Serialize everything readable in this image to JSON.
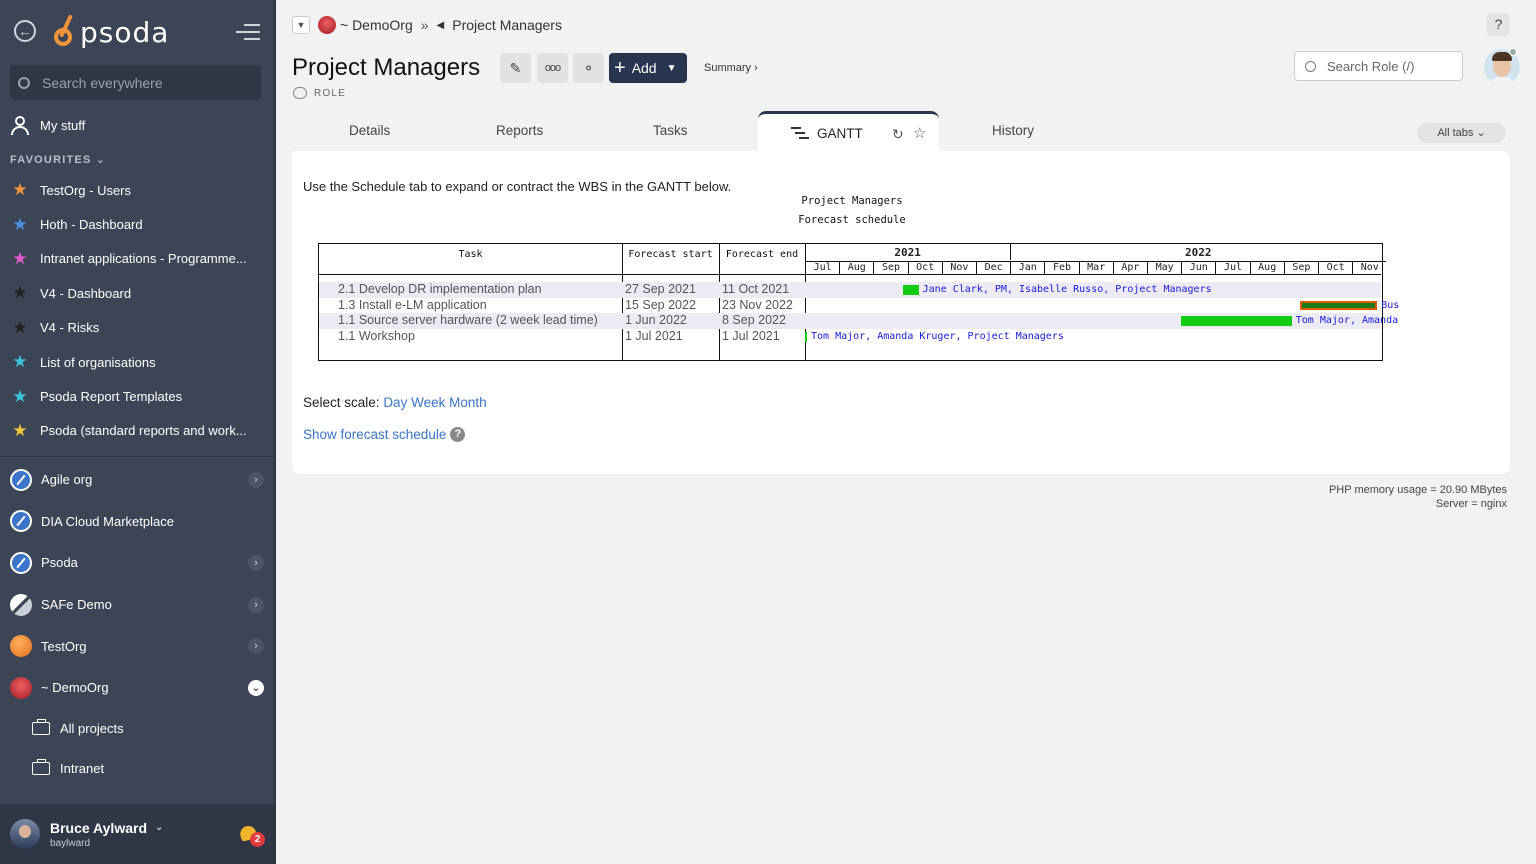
{
  "sidebar": {
    "logo_text": "psoda",
    "search_placeholder": "Search everywhere",
    "my_stuff": "My stuff",
    "favourites_header": "FAVOURITES",
    "favourites": [
      {
        "label": "TestOrg - Users",
        "color": "#f0953a"
      },
      {
        "label": "Hoth - Dashboard",
        "color": "#4a8fe0"
      },
      {
        "label": "Intranet applications - Programme...",
        "color": "#e05ad0"
      },
      {
        "label": "V4 - Dashboard",
        "color": "#222222"
      },
      {
        "label": "V4 - Risks",
        "color": "#222222"
      },
      {
        "label": "List of organisations",
        "color": "#3bc4d8"
      },
      {
        "label": "Psoda Report Templates",
        "color": "#3bc4d8"
      },
      {
        "label": "Psoda (standard reports and work...",
        "color": "#f0c43a"
      }
    ],
    "orgs": [
      {
        "label": "Agile org",
        "icon": "compass",
        "chevron": true
      },
      {
        "label": "DIA Cloud Marketplace",
        "icon": "compass",
        "chevron": false
      },
      {
        "label": "Psoda",
        "icon": "compass",
        "chevron": true
      },
      {
        "label": "SAFe Demo",
        "icon": "safe",
        "chevron": true
      },
      {
        "label": "TestOrg",
        "icon": "testorg",
        "chevron": true
      },
      {
        "label": "~ DemoOrg",
        "icon": "demoorg",
        "chevron": true,
        "open": true
      }
    ],
    "sub_items": [
      "All projects",
      "Intranet"
    ],
    "user": {
      "name": "Bruce Aylward",
      "login": "baylward",
      "notifications": "2"
    }
  },
  "header": {
    "crumb_org": "~ DemoOrg",
    "crumb_current": "Project Managers",
    "help": "?",
    "title": "Project Managers",
    "add_label": "Add",
    "summary_label": "Summary ›",
    "type_label": "ROLE",
    "search_placeholder": "Search Role (/)"
  },
  "tabs": {
    "details": "Details",
    "reports": "Reports",
    "tasks": "Tasks",
    "gantt": "GANTT",
    "history": "History",
    "all_tabs": "All tabs"
  },
  "content": {
    "intro": "Use the Schedule tab to expand or contract the WBS in the GANTT below.",
    "scale_label": "Select scale:",
    "scale_options": [
      "Day",
      "Week",
      "Month"
    ],
    "forecast_link": "Show forecast schedule"
  },
  "gantt": {
    "title": "Project Managers",
    "subtitle": "Forecast schedule",
    "col_task": "Task",
    "col_start": "Forecast start",
    "col_end": "Forecast end",
    "years": [
      {
        "label": "2021",
        "months": [
          "Jul",
          "Aug",
          "Sep",
          "Oct",
          "Nov",
          "Dec"
        ]
      },
      {
        "label": "2022",
        "months": [
          "Jan",
          "Feb",
          "Mar",
          "Apr",
          "May",
          "Jun",
          "Jul",
          "Aug",
          "Sep",
          "Oct",
          "Nov"
        ]
      }
    ],
    "rows": [
      {
        "task": "2.1 Develop DR implementation plan",
        "start": "27 Sep 2021",
        "end": "11 Oct 2021",
        "label": "Jane Clark, PM, Isabelle Russo, Project Managers",
        "color": "#11cc11"
      },
      {
        "task": "1.3 Install e-LM application",
        "start": "15 Sep 2022",
        "end": "23 Nov 2022",
        "label": "Bus",
        "color": "#e05a00"
      },
      {
        "task": "1.1 Source server hardware (2 week lead time)",
        "start": "1 Jun 2022",
        "end": "8 Sep 2022",
        "label": "Tom Major, Amanda",
        "color": "#11cc11"
      },
      {
        "task": "1.1 Workshop",
        "start": "1 Jul 2021",
        "end": "1 Jul 2021",
        "label": "Tom Major, Amanda Kruger, Project Managers",
        "color": "#11cc11"
      }
    ]
  },
  "footer": {
    "memory": "PHP memory usage = 20.90 MBytes",
    "server": "Server = nginx"
  }
}
